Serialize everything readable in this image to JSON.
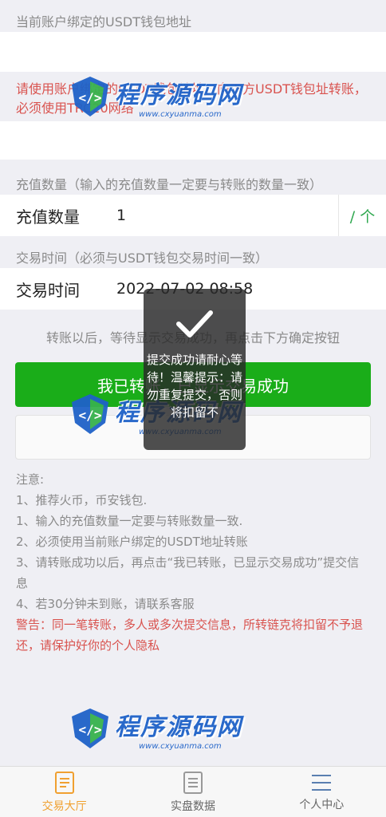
{
  "address_section": {
    "label": "当前账户绑定的USDT钱包地址",
    "address_value": "",
    "instruction": "请使用账户绑定的USDT钱包地址，向下方USDT钱包址转账，必须使用TRC20网络"
  },
  "amount_section": {
    "label": "充值数量（输入的充值数量一定要与转账的数量一致）",
    "field_label": "充值数量",
    "field_value": "1",
    "unit": "/ 个"
  },
  "time_section": {
    "label": "交易时间（必须与USDT钱包交易时间一致）",
    "field_label": "交易时间",
    "field_value": "2022-07-02 08:58"
  },
  "hint": "转账以后，等待显示交易成功，再点击下方确定按钮",
  "confirm_button": "我已转账，已显示交易成功",
  "notes": {
    "title": "注意:",
    "items": [
      "1、推荐火币，币安钱包.",
      "1、输入的充值数量一定要与转账数量一致.",
      "2、必须使用当前账户绑定的USDT地址转账",
      "3、请转账成功以后，再点击“我已转账，已显示交易成功”提交信息",
      "4、若30分钟未到账，请联系客服"
    ],
    "warning": "警告：同一笔转账，多人或多次提交信息，所转链克将扣留不予退还，请保护好你的个人隐私"
  },
  "toast": {
    "message": "提交成功请耐心等待！温馨提示：请勿重复提交，否则将扣留不"
  },
  "watermark": {
    "name": "程序源码网",
    "url": "www.cxyuanma.com"
  },
  "tabbar": {
    "items": [
      {
        "label": "交易大厅",
        "icon": "document-icon",
        "active": true
      },
      {
        "label": "实盘数据",
        "icon": "list-icon",
        "active": false
      },
      {
        "label": "个人中心",
        "icon": "menu-icon",
        "active": false
      }
    ]
  },
  "colors": {
    "accent_green": "#1aad19",
    "warning_red": "#d9534f",
    "active_tab": "#f0a030",
    "watermark_blue": "#1f62c8"
  }
}
